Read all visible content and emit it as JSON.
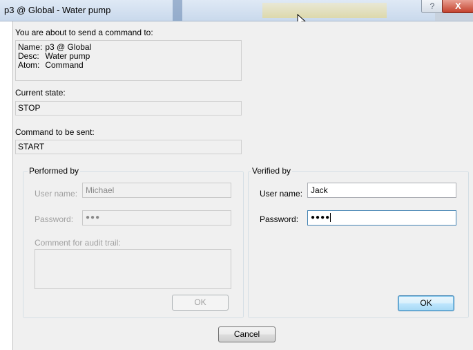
{
  "window": {
    "title": "p3 @ Global - Water pump",
    "help_label": "?",
    "close_label": "X"
  },
  "info": {
    "intro": "You are about to send a command to:",
    "name_label": "Name:",
    "name_value": "p3 @ Global",
    "desc_label": "Desc:",
    "desc_value": "Water pump",
    "atom_label": "Atom:",
    "atom_value": "Command"
  },
  "current_state": {
    "label": "Current state:",
    "value": "STOP"
  },
  "command": {
    "label": "Command to be sent:",
    "value": "START"
  },
  "performed_by": {
    "title": "Performed by",
    "username_label": "User name:",
    "username_value": "Michael",
    "password_label": "Password:",
    "password_value": "●●●",
    "comment_label": "Comment for audit trail:",
    "comment_value": "",
    "ok_label": "OK",
    "enabled": false
  },
  "verified_by": {
    "title": "Verified by",
    "username_label": "User name:",
    "username_value": "Jack",
    "password_label": "Password:",
    "password_value": "●●●●",
    "ok_label": "OK",
    "enabled": true
  },
  "footer": {
    "cancel_label": "Cancel"
  }
}
